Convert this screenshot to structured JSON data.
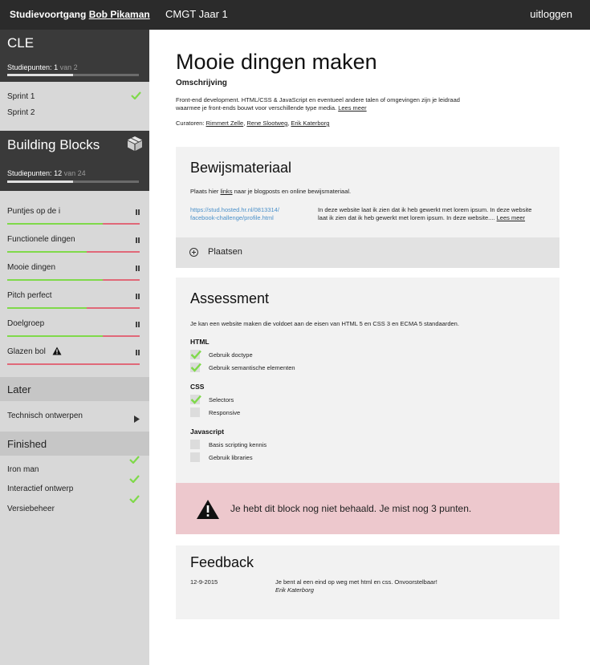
{
  "topbar": {
    "prefix": "Studievoortgang",
    "user": "Bob Pikaman",
    "course": "CMGT Jaar 1",
    "logout": "uitloggen"
  },
  "sidebar": {
    "cle": {
      "title": "CLE",
      "points_label": "Studiepunten:",
      "points": "1",
      "points_of": "van 2",
      "progress": 0.5,
      "items": [
        {
          "label": "Sprint 1",
          "done": true
        },
        {
          "label": "Sprint 2",
          "done": false
        }
      ]
    },
    "building_blocks": {
      "title": "Building Blocks",
      "icon": "box-icon",
      "points_label": "Studiepunten:",
      "points": "12",
      "points_of": "van 24",
      "progress": 0.5,
      "items": [
        {
          "label": "Puntjes op de i",
          "progress": 0.72,
          "warning": false
        },
        {
          "label": "Functionele dingen",
          "progress": 0.6,
          "warning": false
        },
        {
          "label": "Mooie dingen",
          "progress": 0.72,
          "warning": false
        },
        {
          "label": "Pitch perfect",
          "progress": 0.6,
          "warning": false
        },
        {
          "label": "Doelgroep",
          "progress": 0.72,
          "warning": false
        },
        {
          "label": "Glazen bol",
          "progress": 0.0,
          "warning": true
        }
      ]
    },
    "later": {
      "title": "Later",
      "items": [
        {
          "label": "Technisch ontwerpen"
        }
      ]
    },
    "finished": {
      "title": "Finished",
      "items": [
        {
          "label": "Iron man"
        },
        {
          "label": "Interactief ontwerp"
        },
        {
          "label": "Versiebeheer"
        }
      ]
    }
  },
  "main": {
    "title": "Mooie dingen maken",
    "subtitle": "Omschrijving",
    "description": "Front-end development. HTML/CSS & JavaScript en eventueel andere talen of omgevingen zijn je leidraad waarmee je front-ends bouwt voor verschillende type media.",
    "read_more": "Lees meer",
    "curators_label": "Curatoren:",
    "curators": [
      "Rimmert Zelle",
      "Rene Slootweg",
      "Erik Katerborg"
    ],
    "evidence": {
      "title": "Bewijsmateriaal",
      "intro_before": "Plaats hier",
      "intro_link": "links",
      "intro_after": "naar je blogposts en online bewijsmateriaal.",
      "link": "https://stud.hosted.hr.nl/0813314/ facebook-challenge/profile.html",
      "text": "In deze website laat ik zien dat ik heb gewerkt met lorem ipsum. In deze website laat ik zien dat ik heb gewerkt met lorem ipsum. In deze website.... ",
      "text_more": "Lees meer",
      "place_label": "Plaatsen"
    },
    "assessment": {
      "title": "Assessment",
      "intro": "Je kan een website maken die voldoet aan de eisen van HTML 5 en CSS 3 en ECMA 5 standaarden.",
      "groups": [
        {
          "name": "HTML",
          "criteria": [
            {
              "label": "Gebruik doctype",
              "checked": true
            },
            {
              "label": "Gebruik semantische elementen",
              "checked": true
            }
          ]
        },
        {
          "name": "CSS",
          "criteria": [
            {
              "label": "Selectors",
              "checked": true
            },
            {
              "label": "Responsive",
              "checked": false
            }
          ]
        },
        {
          "name": "Javascript",
          "criteria": [
            {
              "label": "Basis scripting kennis",
              "checked": false
            },
            {
              "label": "Gebruik libraries",
              "checked": false
            }
          ]
        }
      ]
    },
    "alert": {
      "message": "Je hebt dit block nog niet behaald. Je mist nog 3 punten.",
      "icon": "warning-icon"
    },
    "feedback": {
      "title": "Feedback",
      "entries": [
        {
          "date": "12-9-2015",
          "text": "Je bent al een eind op weg met html en css. Onvoorstelbaar!",
          "author": "Erik Katerborg"
        }
      ]
    }
  },
  "colors": {
    "topbar": "#2b2b2b",
    "sidebar": "#d8d8d8",
    "block_head": "#3a3a3a",
    "check_green": "#7fd94a",
    "bar_red": "#e06878",
    "alert_bg": "#edc8cd",
    "link_blue": "#4a90c9"
  }
}
